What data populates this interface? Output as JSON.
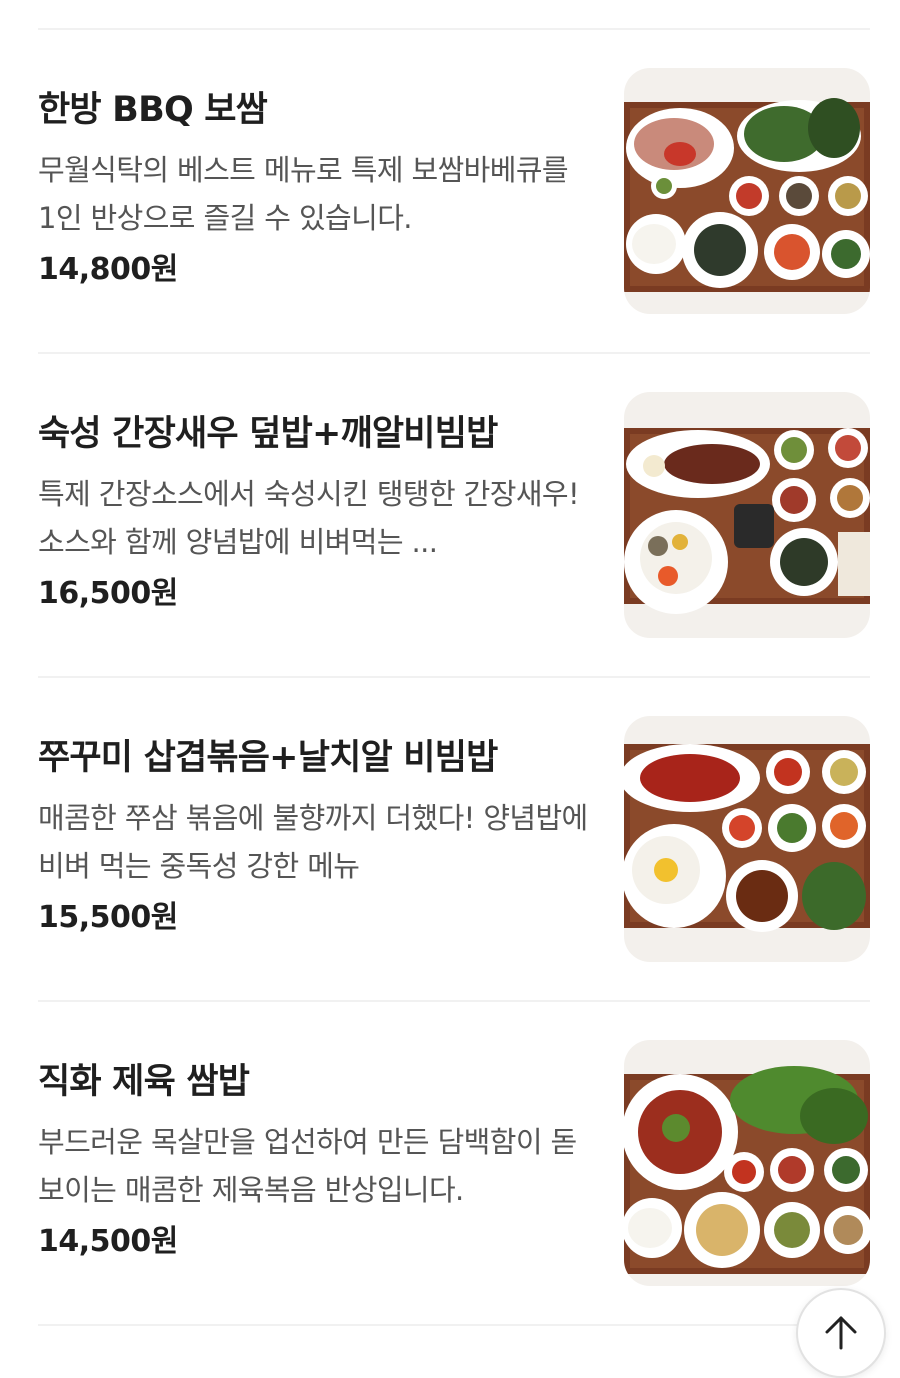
{
  "menu": {
    "items": [
      {
        "name": "한방 BBQ 보쌈",
        "description": "무월식탁의 베스트 메뉴로 특제 보쌈바베큐를 1인 반상으로 즐길 수 있습니다.",
        "price": "14,800원",
        "image_label": "한방 BBQ 보쌈 반상 사진"
      },
      {
        "name": "숙성 간장새우 덮밥+깨알비빔밥",
        "description": "특제 간장소스에서 숙성시킨 탱탱한 간장새우! 소스와 함께 양념밥에 비벼먹는 ...",
        "price": "16,500원",
        "image_label": "숙성 간장새우 덮밥 반상 사진"
      },
      {
        "name": "쭈꾸미 삽겹볶음+날치알 비빔밥",
        "description": "매콤한 쭈삼 볶음에 불향까지 더했다! 양념밥에 비벼 먹는 중독성 강한 메뉴",
        "price": "15,500원",
        "image_label": "쭈꾸미 삼겹볶음 반상 사진"
      },
      {
        "name": "직화 제육 쌈밥",
        "description": "부드러운 목살만을 업선하여 만든 담백함이 돋보이는 매콤한 제육복음 반상입니다.",
        "price": "14,500원",
        "image_label": "직화 제육 쌈밥 반상 사진"
      }
    ]
  },
  "scroll_top": {
    "icon": "arrow-up-icon"
  },
  "colors": {
    "tray": "#7a3b22",
    "plate": "#ffffff",
    "divider": "#f1f1f1",
    "price_text": "#1f1f1f",
    "desc_text": "#555555"
  }
}
